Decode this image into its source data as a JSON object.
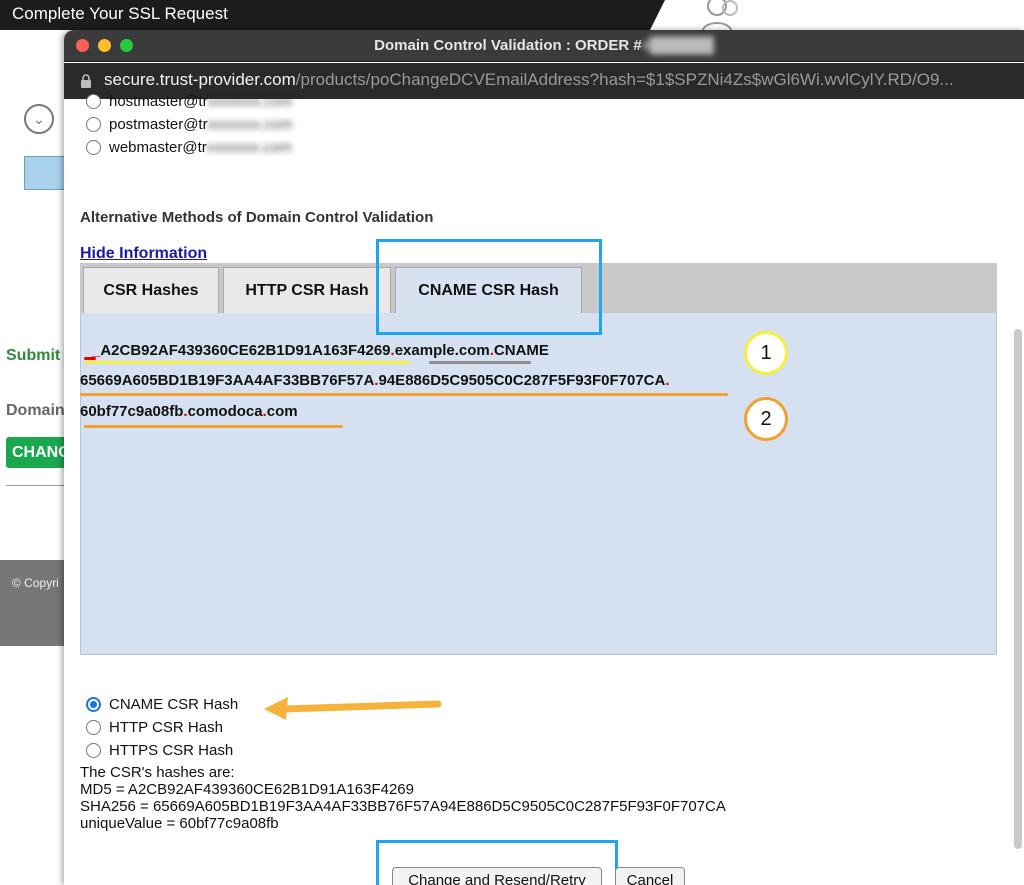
{
  "background_page": {
    "title": "Complete Your SSL Request",
    "submit_label": "Submit",
    "domain_label": "Domain",
    "change_button": "CHANGE",
    "footer_copy": "© Copyri"
  },
  "window": {
    "title_prefix": "Domain Control Validation : ORDER #",
    "title_order_blurred": "4██████",
    "url_host": "secure.trust-provider.com",
    "url_rest": "/products/poChangeDCVEmailAddress?hash=$1$SPZNi4Zs$wGl6Wi.wvlCylY.RD/O9..."
  },
  "email_options": [
    {
      "prefix": "hostmaster@tr",
      "blurred": "xxxxxxx.com"
    },
    {
      "prefix": "postmaster@tr",
      "blurred": "xxxxxxx.com"
    },
    {
      "prefix": "webmaster@tr",
      "blurred": "xxxxxxx.com"
    }
  ],
  "alt_methods_title": "Alternative Methods of Domain Control Validation",
  "hide_info_link": "Hide Information",
  "tabs": [
    "CSR Hashes",
    "HTTP CSR Hash",
    "CNAME CSR Hash"
  ],
  "cname": {
    "line1": {
      "underscore": "_",
      "hash": "A2CB92AF439360CE62B1D91A163F4269",
      "dot": ".",
      "domain": "example.com",
      "dot2": ".",
      "suffix": "CNAME"
    },
    "line2": {
      "part1": "65669A605BD1B19F3AA4AF33BB76F57A",
      "dot": ".",
      "part2": "94E886D5C9505C0C287F5F93F0F707CA",
      "dot2": "."
    },
    "line3": {
      "part1": "60bf77c9a08fb",
      "dot": ".",
      "part2": "comodoca",
      "dot2": ".",
      "part3": "com"
    },
    "badge1": "1",
    "badge2": "2"
  },
  "methods": [
    {
      "label": "CNAME CSR Hash",
      "checked": true
    },
    {
      "label": "HTTP CSR Hash",
      "checked": false
    },
    {
      "label": "HTTPS CSR Hash",
      "checked": false
    }
  ],
  "hashes": {
    "intro": "The CSR's hashes are:",
    "md5": "MD5 = A2CB92AF439360CE62B1D91A163F4269",
    "sha256": "SHA256 = 65669A605BD1B19F3AA4AF33BB76F57A94E886D5C9505C0C287F5F93F0F707CA",
    "unique": "uniqueValue = 60bf77c9a08fb"
  },
  "buttons": {
    "change": "Change and Resend/Retry",
    "cancel": "Cancel"
  },
  "colors": {
    "highlight_box": "#1ea6f5",
    "underline_yellow": "#f7ef3a",
    "underline_orange": "#f2a032",
    "underline_gray": "#8c8c8c",
    "arrow": "#f6b33b",
    "dot_red": "#e00000"
  }
}
